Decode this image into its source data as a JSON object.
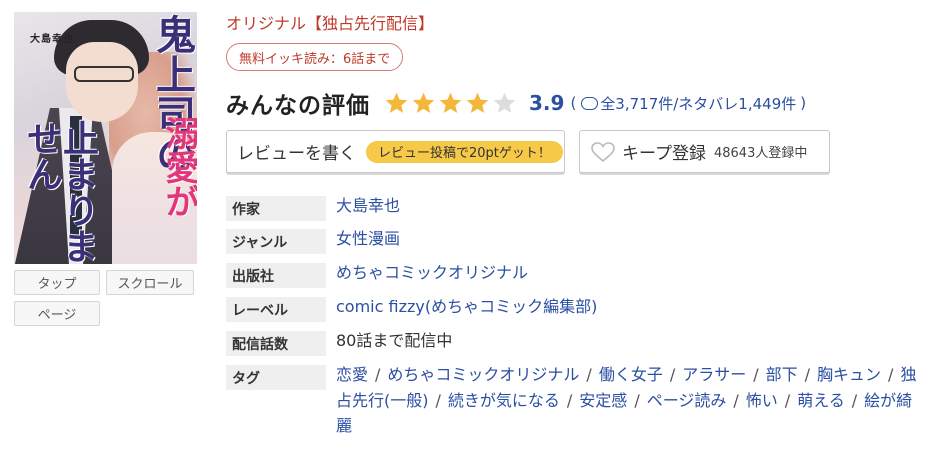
{
  "cover": {
    "author_text": "大島幸也",
    "title_line1": "鬼上司の",
    "title_line2": "溺愛が",
    "title_line3": "止まりません",
    "title_ga": "が"
  },
  "viewer_buttons": {
    "tap": "タップ",
    "scroll": "スクロール",
    "page": "ページ"
  },
  "header": {
    "label": "オリジナル【独占先行配信】",
    "free_badge": "無料イッキ読み：6話まで"
  },
  "rating": {
    "title": "みんなの評価",
    "stars_filled": 4,
    "stars_total": 5,
    "score": "3.9",
    "counts_open": "(",
    "counts_text": "全3,717件/ネタバレ1,449件",
    "counts_close": ")",
    "star_color": "#f4b73a",
    "star_empty_color": "#dddddd"
  },
  "actions": {
    "review_label": "レビューを書く",
    "review_badge": "レビュー投稿で20ptゲット！",
    "keep_label": "キープ登録",
    "keep_count": "48643人登録中"
  },
  "info": {
    "author_label": "作家",
    "author_value": "大島幸也",
    "genre_label": "ジャンル",
    "genre_value": "女性漫画",
    "publisher_label": "出版社",
    "publisher_value": "めちゃコミックオリジナル",
    "label_label": "レーベル",
    "label_value": "comic fizzy(めちゃコミック編集部)",
    "episodes_label": "配信話数",
    "episodes_value": "80話まで配信中",
    "tags_label": "タグ",
    "tags": [
      "恋愛",
      "めちゃコミックオリジナル",
      "働く女子",
      "アラサー",
      "部下",
      "胸キュン",
      "独占先行(一般)",
      "続きが気になる",
      "安定感",
      "ページ読み",
      "怖い",
      "萌える",
      "絵が綺麗"
    ]
  },
  "colors": {
    "link": "#2b4fa3",
    "accent_red": "#c0392b",
    "badge_yellow": "#f7c948"
  }
}
